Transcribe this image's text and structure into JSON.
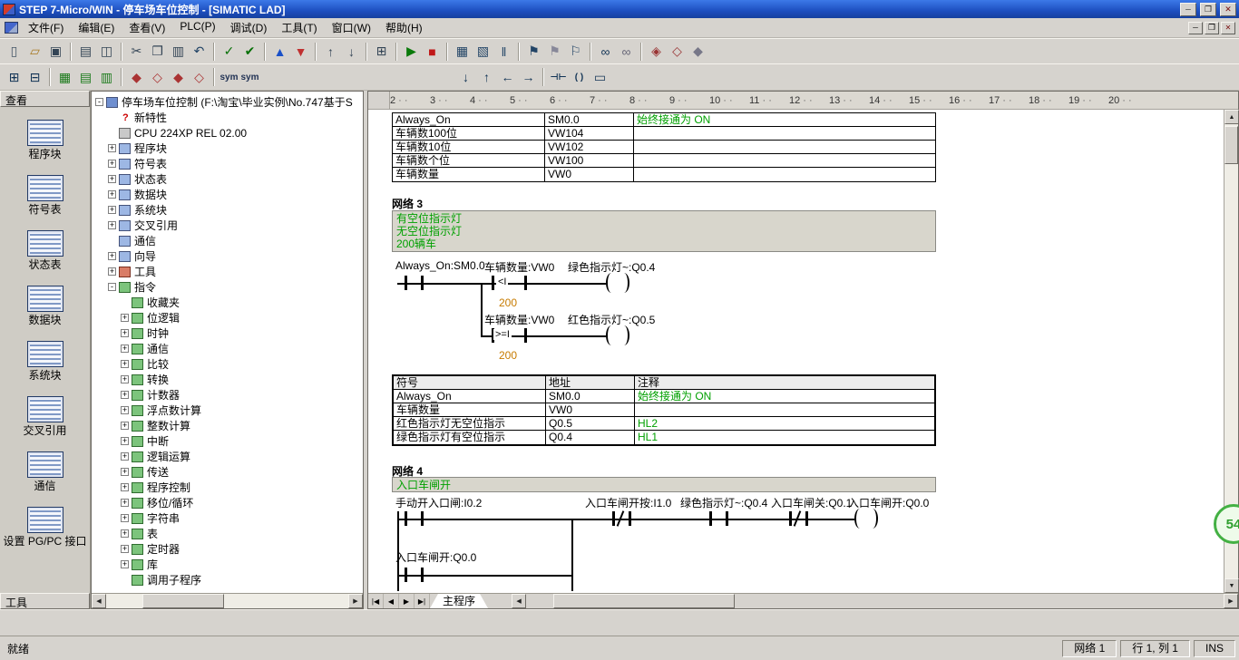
{
  "window": {
    "title": "STEP 7-Micro/WIN - 停车场车位控制 - [SIMATIC LAD]"
  },
  "menu": {
    "items": [
      "文件(F)",
      "编辑(E)",
      "查看(V)",
      "PLC(P)",
      "调试(D)",
      "工具(T)",
      "窗口(W)",
      "帮助(H)"
    ]
  },
  "toolbar_main": {
    "items": [
      {
        "name": "new-file-icon",
        "glyph": "▯",
        "color": "#445566"
      },
      {
        "name": "open-file-icon",
        "glyph": "▱",
        "color": "#a87820"
      },
      {
        "name": "save-icon",
        "glyph": "▣",
        "color": "#334455"
      },
      {
        "sep": 1
      },
      {
        "name": "print-icon",
        "glyph": "▤",
        "color": "#334455"
      },
      {
        "name": "print-preview-icon",
        "glyph": "◫",
        "color": "#334455"
      },
      {
        "sep": 1
      },
      {
        "name": "cut-icon",
        "glyph": "✂",
        "color": "#334455"
      },
      {
        "name": "copy-icon",
        "glyph": "❐",
        "color": "#334455"
      },
      {
        "name": "paste-icon",
        "glyph": "▥",
        "color": "#334455"
      },
      {
        "name": "undo-icon",
        "glyph": "↶",
        "color": "#224466"
      },
      {
        "sep": 1
      },
      {
        "name": "compile-icon",
        "glyph": "✓",
        "color": "#067006"
      },
      {
        "name": "compile-all-icon",
        "glyph": "✔",
        "color": "#067006"
      },
      {
        "sep": 1
      },
      {
        "name": "upload-icon",
        "glyph": "▲",
        "color": "#1a50c8"
      },
      {
        "name": "download-icon",
        "glyph": "▼",
        "color": "#c03030"
      },
      {
        "sep": 1
      },
      {
        "name": "sort-ascending-icon",
        "glyph": "↑",
        "color": "#334455"
      },
      {
        "name": "sort-descending-icon",
        "glyph": "↓",
        "color": "#334455"
      },
      {
        "sep": 1
      },
      {
        "name": "options-icon",
        "glyph": "⊞",
        "color": "#334455"
      },
      {
        "sep": 1
      },
      {
        "name": "run-icon",
        "glyph": "▶",
        "color": "#0a7a0a"
      },
      {
        "name": "stop-icon",
        "glyph": "■",
        "color": "#c01818"
      },
      {
        "sep": 1
      },
      {
        "name": "program-status-icon",
        "glyph": "▦",
        "color": "#224466"
      },
      {
        "name": "chart-status-icon",
        "glyph": "▧",
        "color": "#224466"
      },
      {
        "name": "pause-status-icon",
        "glyph": "‖",
        "color": "#224466"
      },
      {
        "sep": 1
      },
      {
        "name": "bookmark-icon",
        "glyph": "⚑",
        "color": "#224466"
      },
      {
        "name": "next-bookmark-icon",
        "glyph": "⚑",
        "color": "#888899"
      },
      {
        "name": "previous-bookmark-icon",
        "glyph": "⚐",
        "color": "#224466"
      },
      {
        "sep": 1
      },
      {
        "name": "status-monitor-icon",
        "glyph": "∞",
        "color": "#113355"
      },
      {
        "name": "pause-monitor-icon",
        "glyph": "∞",
        "color": "#666677"
      },
      {
        "sep": 1
      },
      {
        "name": "force-icon",
        "glyph": "◈",
        "color": "#993333"
      },
      {
        "name": "unforce-icon",
        "glyph": "◇",
        "color": "#993333"
      },
      {
        "name": "read-all-forced-icon",
        "glyph": "◆",
        "color": "#777788"
      }
    ]
  },
  "toolbar_instr": {
    "items": [
      {
        "name": "insert-network-icon",
        "glyph": "⊞",
        "color": "#113355"
      },
      {
        "name": "delete-network-icon",
        "glyph": "⊟",
        "color": "#113355"
      },
      {
        "sep": 1
      },
      {
        "name": "view-symbol-table-icon",
        "glyph": "▦",
        "color": "#1a7a1a"
      },
      {
        "name": "symbol-info-table-icon",
        "glyph": "▤",
        "color": "#1a7a1a"
      },
      {
        "name": "apply-symbols-icon",
        "glyph": "▥",
        "color": "#1a7a1a"
      },
      {
        "sep": 1
      },
      {
        "name": "insert-row-icon",
        "glyph": "◆",
        "color": "#aa3333"
      },
      {
        "name": "delete-row-icon",
        "glyph": "◇",
        "color": "#aa3333"
      },
      {
        "name": "insert-column-icon",
        "glyph": "◆",
        "color": "#aa3333"
      },
      {
        "name": "delete-column-icon",
        "glyph": "◇",
        "color": "#aa3333"
      },
      {
        "sep": 1
      },
      {
        "name": "symbolic-addressing-toggle-icon",
        "glyph": "sym",
        "cls": "small",
        "color": "#223355"
      },
      {
        "name": "symbol-comment-toggle-icon",
        "glyph": "sym",
        "cls": "small",
        "color": "#223355"
      },
      {
        "gap": 215
      },
      {
        "name": "line-down-icon",
        "glyph": "↓",
        "color": "#113355"
      },
      {
        "name": "line-up-icon",
        "glyph": "↑",
        "color": "#113355"
      },
      {
        "name": "line-left-icon",
        "glyph": "←",
        "color": "#113355"
      },
      {
        "name": "line-right-icon",
        "glyph": "→",
        "color": "#113355"
      },
      {
        "sep": 1
      },
      {
        "name": "insert-contact-icon",
        "glyph": "⊣⊢",
        "cls": "small",
        "color": "#113355"
      },
      {
        "name": "insert-coil-icon",
        "glyph": "( )",
        "cls": "small",
        "color": "#113355"
      },
      {
        "name": "insert-box-icon",
        "glyph": "▭",
        "color": "#113355"
      }
    ]
  },
  "nav": {
    "header": "查看",
    "footer": "工具",
    "items": [
      {
        "label": "程序块",
        "name": "sidebar-item-program-block",
        "icon": "program-block-icon"
      },
      {
        "label": "符号表",
        "name": "sidebar-item-symbol-table",
        "icon": "symbol-table-icon"
      },
      {
        "label": "状态表",
        "name": "sidebar-item-status-chart",
        "icon": "status-chart-icon"
      },
      {
        "label": "数据块",
        "name": "sidebar-item-data-block",
        "icon": "data-block-icon"
      },
      {
        "label": "系统块",
        "name": "sidebar-item-system-block",
        "icon": "system-block-icon"
      },
      {
        "label": "交叉引用",
        "name": "sidebar-item-cross-reference",
        "icon": "cross-reference-icon"
      },
      {
        "label": "通信",
        "name": "sidebar-item-communications",
        "icon": "communications-icon"
      },
      {
        "label": "设置 PG/PC 接口",
        "name": "sidebar-item-set-pg-pc-interface",
        "icon": "pg-pc-interface-icon"
      }
    ]
  },
  "tree": {
    "items": [
      {
        "label": "停车场车位控制 (F:\\淘宝\\毕业实例\\No.747基于S",
        "lvl": "lvl0",
        "exp": "-",
        "ic": "proj",
        "icon": "project-icon"
      },
      {
        "label": "新特性",
        "lvl": "lvl1",
        "exp": "",
        "ic": "redq",
        "icon": "whats-new-icon"
      },
      {
        "label": "CPU 224XP REL 02.00",
        "lvl": "lvl1",
        "exp": "",
        "ic": "gray",
        "icon": "cpu-icon"
      },
      {
        "label": "程序块",
        "lvl": "lvl1",
        "exp": "+",
        "ic": "blue",
        "icon": "program-block-icon"
      },
      {
        "label": "符号表",
        "lvl": "lvl1",
        "exp": "+",
        "ic": "blue",
        "icon": "symbol-table-icon"
      },
      {
        "label": "状态表",
        "lvl": "lvl1",
        "exp": "+",
        "ic": "blue",
        "icon": "status-chart-icon"
      },
      {
        "label": "数据块",
        "lvl": "lvl1",
        "exp": "+",
        "ic": "blue",
        "icon": "data-block-icon"
      },
      {
        "label": "系统块",
        "lvl": "lvl1",
        "exp": "+",
        "ic": "blue",
        "icon": "system-block-icon"
      },
      {
        "label": "交叉引用",
        "lvl": "lvl1",
        "exp": "+",
        "ic": "blue",
        "icon": "cross-reference-icon"
      },
      {
        "label": "通信",
        "lvl": "lvl1",
        "exp": "",
        "ic": "blue",
        "icon": "communications-icon"
      },
      {
        "label": "向导",
        "lvl": "lvl1",
        "exp": "+",
        "ic": "blue",
        "icon": "wizard-icon"
      },
      {
        "label": "工具",
        "lvl": "lvl1",
        "exp": "+",
        "ic": "tools",
        "icon": "tools-icon"
      },
      {
        "label": "指令",
        "lvl": "lvl1",
        "exp": "-",
        "ic": "green",
        "icon": "instructions-icon"
      },
      {
        "label": "收藏夹",
        "lvl": "lvl2",
        "exp": "",
        "ic": "green",
        "icon": "favorites-icon"
      },
      {
        "label": "位逻辑",
        "lvl": "lvl2",
        "exp": "+",
        "ic": "green",
        "icon": "bit-logic-icon"
      },
      {
        "label": "时钟",
        "lvl": "lvl2",
        "exp": "+",
        "ic": "green",
        "icon": "clock-icon"
      },
      {
        "label": "通信",
        "lvl": "lvl2",
        "exp": "+",
        "ic": "green",
        "icon": "communications-instructions-icon"
      },
      {
        "label": "比较",
        "lvl": "lvl2",
        "exp": "+",
        "ic": "green",
        "icon": "compare-icon"
      },
      {
        "label": "转换",
        "lvl": "lvl2",
        "exp": "+",
        "ic": "green",
        "icon": "convert-icon"
      },
      {
        "label": "计数器",
        "lvl": "lvl2",
        "exp": "+",
        "ic": "green",
        "icon": "counters-icon"
      },
      {
        "label": "浮点数计算",
        "lvl": "lvl2",
        "exp": "+",
        "ic": "green",
        "icon": "floating-point-math-icon"
      },
      {
        "label": "整数计算",
        "lvl": "lvl2",
        "exp": "+",
        "ic": "green",
        "icon": "integer-math-icon"
      },
      {
        "label": "中断",
        "lvl": "lvl2",
        "exp": "+",
        "ic": "green",
        "icon": "interrupt-icon"
      },
      {
        "label": "逻辑运算",
        "lvl": "lvl2",
        "exp": "+",
        "ic": "green",
        "icon": "logical-operations-icon"
      },
      {
        "label": "传送",
        "lvl": "lvl2",
        "exp": "+",
        "ic": "green",
        "icon": "move-icon"
      },
      {
        "label": "程序控制",
        "lvl": "lvl2",
        "exp": "+",
        "ic": "green",
        "icon": "program-control-icon"
      },
      {
        "label": "移位/循环",
        "lvl": "lvl2",
        "exp": "+",
        "ic": "green",
        "icon": "shift-rotate-icon"
      },
      {
        "label": "字符串",
        "lvl": "lvl2",
        "exp": "+",
        "ic": "green",
        "icon": "string-icon"
      },
      {
        "label": "表",
        "lvl": "lvl2",
        "exp": "+",
        "ic": "green",
        "icon": "table-icon"
      },
      {
        "label": "定时器",
        "lvl": "lvl2",
        "exp": "+",
        "ic": "green",
        "icon": "timers-icon"
      },
      {
        "label": "库",
        "lvl": "lvl2",
        "exp": "+",
        "ic": "green",
        "icon": "libraries-icon"
      },
      {
        "label": "调用子程序",
        "lvl": "lvl2",
        "exp": "",
        "ic": "green",
        "icon": "call-subroutines-icon"
      }
    ]
  },
  "editor": {
    "ruler_numbers": [
      2,
      3,
      4,
      5,
      6,
      7,
      8,
      9,
      10,
      11,
      12,
      13,
      14,
      15,
      16,
      17,
      18,
      19,
      20
    ],
    "table_top": {
      "rows": [
        [
          "Always_On",
          "SM0.0",
          "始终接通为 ON"
        ],
        [
          "车辆数100位",
          "VW104",
          ""
        ],
        [
          "车辆数10位",
          "VW102",
          ""
        ],
        [
          "车辆数个位",
          "VW100",
          ""
        ],
        [
          "车辆数量",
          "VW0",
          ""
        ]
      ]
    },
    "net3": {
      "title": "网络 3",
      "comment_lines": [
        "有空位指示灯",
        "无空位指示灯",
        "200辆车"
      ],
      "rung1": {
        "contact": "Always_On:SM0.0",
        "cmp_label": "车辆数量:VW0",
        "cmp_op": "<I",
        "cmp_value": "200",
        "coil": "绿色指示灯~:Q0.4"
      },
      "rung2": {
        "cmp_label": "车辆数量:VW0",
        "cmp_op": ">=I",
        "cmp_value": "200",
        "coil": "红色指示灯~:Q0.5"
      }
    },
    "symbol_table": {
      "headers": [
        "符号",
        "地址",
        "注释"
      ],
      "rows": [
        [
          "Always_On",
          "SM0.0",
          "始终接通为 ON"
        ],
        [
          "车辆数量",
          "VW0",
          ""
        ],
        [
          "红色指示灯无空位指示",
          "Q0.5",
          "HL2"
        ],
        [
          "绿色指示灯有空位指示",
          "Q0.4",
          "HL1"
        ]
      ]
    },
    "net4": {
      "title": "网络 4",
      "comment": "入口车闸开",
      "contact1": "手动开入口闸:I0.2",
      "contact2": "入口车闸开按:I1.0",
      "contact3": "绿色指示灯~:Q0.4",
      "contact4": "入口车闸关:Q0.1",
      "coil": "入口车闸开:Q0.0",
      "branch_contact": "入口车闸开:Q0.0"
    },
    "tab": "主程序",
    "tab_nav": [
      "|◀",
      "◀",
      "▶",
      "▶|"
    ]
  },
  "statusbar": {
    "ready": "就绪",
    "network": "网络 1",
    "position": "行 1, 列 1",
    "mode": "INS"
  },
  "overlay": {
    "badge": "54"
  },
  "colors": {
    "comment_green": "#00a000",
    "operand_orange": "#c77b00",
    "titlebar_blue": "#1d4fc0",
    "run_green": "#0a7a0a",
    "stop_red": "#c01818"
  }
}
